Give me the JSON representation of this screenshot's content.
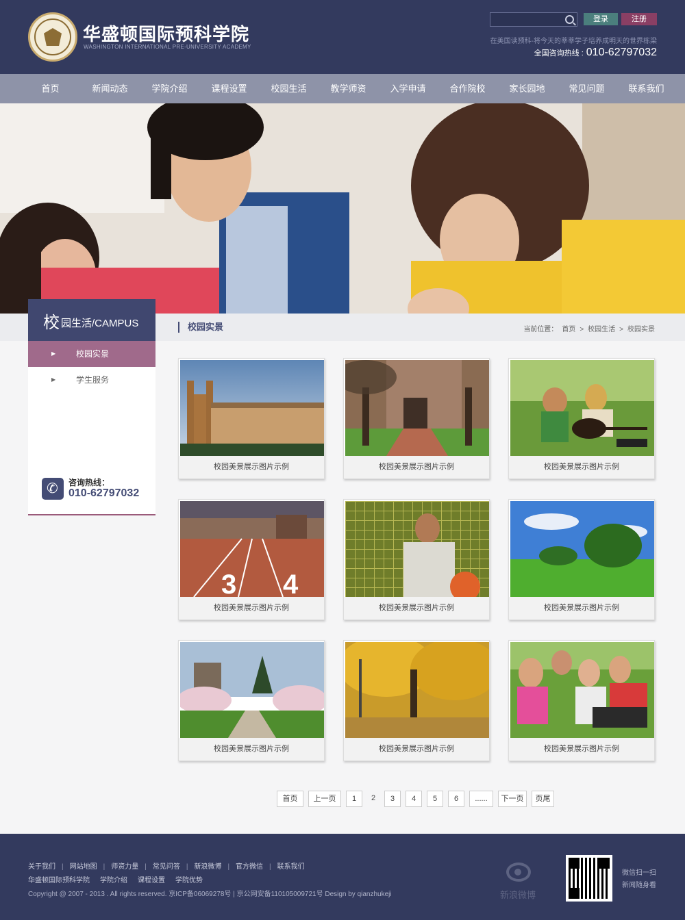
{
  "header": {
    "site_title": "华盛顿国际预科学院",
    "site_subtitle": "WASHINGTON INTERNATIONAL PRE-UNIVERSITY ACADEMY",
    "search_placeholder": "",
    "login_label": "登录",
    "register_label": "注册",
    "slogan": "在美国读预科-将今天的莘莘学子培养成明天的世界栋梁",
    "hotline_label": "全国咨询热线 :",
    "hotline_number": "010-62797032"
  },
  "nav": {
    "items": [
      "首页",
      "新闻动态",
      "学院介绍",
      "课程设置",
      "校园生活",
      "教学师资",
      "入学申请",
      "合作院校",
      "家长园地",
      "常见问题",
      "联系我们"
    ]
  },
  "sidebar": {
    "heading_big": "校",
    "heading_rest": "园生活/CAMPUS",
    "items": [
      {
        "label": "校园实景",
        "active": true
      },
      {
        "label": "学生服务",
        "active": false
      }
    ],
    "contact_label": "咨询热线：",
    "contact_number": "010-62797032"
  },
  "content": {
    "section_title": "校园实景",
    "breadcrumb": [
      "当前位置：",
      "首页",
      ">",
      "校园生活",
      ">",
      "校园实景"
    ],
    "gallery": [
      {
        "caption": "校园美景展示图片示例",
        "icon": "college-building"
      },
      {
        "caption": "校园美景展示图片示例",
        "icon": "campus-tree"
      },
      {
        "caption": "校园美景展示图片示例",
        "icon": "students-guitar"
      },
      {
        "caption": "校园美景展示图片示例",
        "icon": "running-track"
      },
      {
        "caption": "校园美景展示图片示例",
        "icon": "soccer-goalkeeper"
      },
      {
        "caption": "校园美景展示图片示例",
        "icon": "green-field"
      },
      {
        "caption": "校园美景展示图片示例",
        "icon": "cherry-blossom-path"
      },
      {
        "caption": "校园美景展示图片示例",
        "icon": "autumn-trees"
      },
      {
        "caption": "校园美景展示图片示例",
        "icon": "students-group"
      }
    ]
  },
  "pagination": {
    "first": "首页",
    "prev": "上一页",
    "pages": [
      "1",
      "2",
      "3",
      "4",
      "5",
      "6"
    ],
    "current": "2",
    "ellipsis": "......",
    "next": "下一页",
    "last": "页尾"
  },
  "footer": {
    "links": [
      "关于我们",
      "网站地图",
      "师资力量",
      "常见问答",
      "新浪微博",
      "官方微信",
      "联系我们"
    ],
    "links2": [
      "华盛顿国际预科学院",
      "学院介绍",
      "课程设置",
      "学院优势"
    ],
    "copyright": "Copyright @ 2007 - 2013  . All rights reserved.   京ICP备06069278号 | 京公网安备1101050097​21号  Design by qianzhukeji",
    "weibo_label": "新浪微博",
    "qr_line1": "微信扫一扫",
    "qr_line2": "新闻随身看"
  },
  "colors": {
    "header_bg": "#333a5e",
    "nav_bg": "#8e93a8",
    "accent": "#a06a8b",
    "login_btn": "#4b7f7d",
    "register_btn": "#8a3f64"
  }
}
